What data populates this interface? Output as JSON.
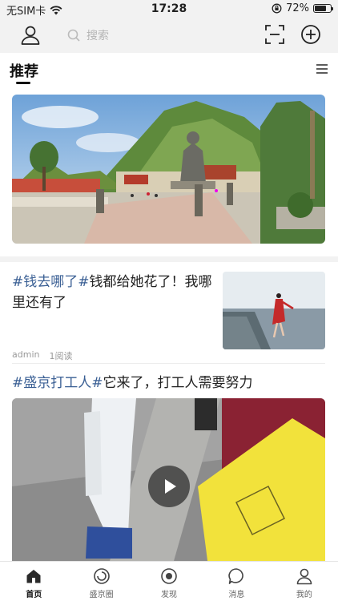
{
  "status_bar": {
    "carrier": "无SIM卡",
    "time": "17:28",
    "battery": "72%",
    "battery_level": 0.72
  },
  "top_bar": {
    "search_placeholder": "搜索"
  },
  "tabs": {
    "active": "推荐"
  },
  "articles": [
    {
      "tag": "#钱去哪了#",
      "text": "钱都给她花了！我哪里还有了",
      "author": "admin",
      "reads": "1阅读"
    }
  ],
  "video_post": {
    "tag": "#盛京打工人#",
    "text": "它来了，打工人需要努力"
  },
  "bottom_nav": {
    "items": [
      {
        "label": "首页",
        "icon": "home-icon",
        "active": true
      },
      {
        "label": "盛京圈",
        "icon": "circle-icon",
        "active": false
      },
      {
        "label": "发现",
        "icon": "discover-icon",
        "active": false
      },
      {
        "label": "消息",
        "icon": "message-icon",
        "active": false
      },
      {
        "label": "我的",
        "icon": "profile-icon",
        "active": false
      }
    ]
  },
  "colors": {
    "tag": "#3a5f94",
    "background": "#f2f2f2",
    "active_tab": "#111111"
  }
}
